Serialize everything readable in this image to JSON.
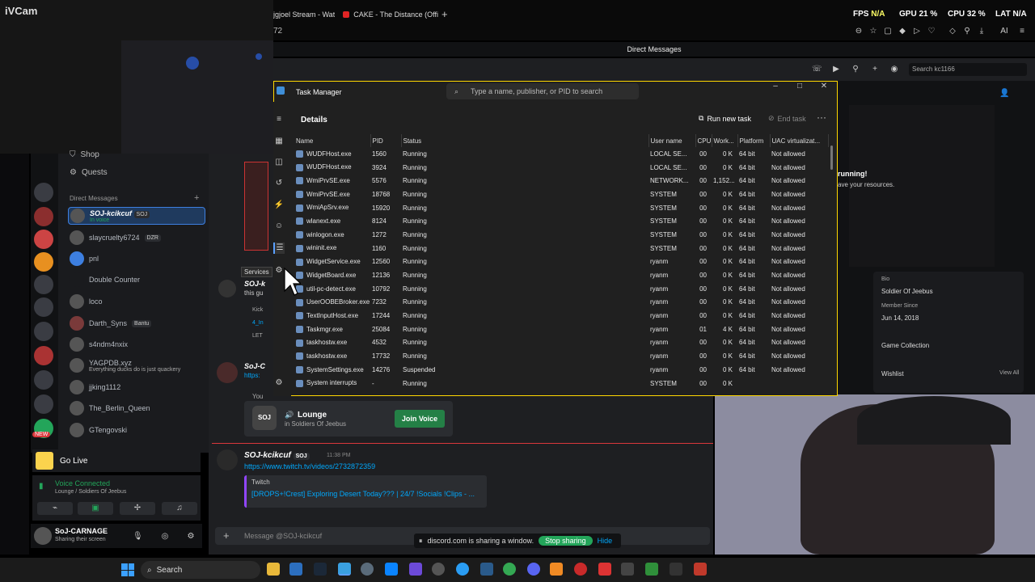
{
  "browser": {
    "tabs": [
      {
        "label": "jgjoel Stream - Wat"
      },
      {
        "label": "CAKE - The Distance (Offi"
      }
    ],
    "new_tab": "+",
    "address_fragment": "72"
  },
  "hud": {
    "fps_label": "FPS",
    "fps_value": "N/A",
    "gpu_label": "GPU",
    "gpu_value": "21 %",
    "cpu_label": "CPU",
    "cpu_value": "32 %",
    "lat_label": "LAT",
    "lat_value": "N/A"
  },
  "ivcam": {
    "label": "iVCam"
  },
  "discord": {
    "header_title": "Direct Messages",
    "search_placeholder": "Search kc1166",
    "nav": {
      "shop": "Shop",
      "quests": "Quests"
    },
    "dm_section": "Direct Messages",
    "dm_plus": "+",
    "dms": [
      {
        "name": "SOJ-kcikcuf",
        "tag": "SOJ",
        "sub": "In voice",
        "active": true
      },
      {
        "name": "slaycruelty6724",
        "tag": "DZR"
      },
      {
        "name": "pnl"
      },
      {
        "name": "Double Counter"
      },
      {
        "name": "loco"
      },
      {
        "name": "Darth_Syns",
        "tag": "Bantu"
      },
      {
        "name": "s4ndm4nxix"
      },
      {
        "name": "YAGPDB.xyz",
        "sub": "Everything ducks do is just quackery"
      },
      {
        "name": "jjking1112"
      },
      {
        "name": "The_Berlin_Queen"
      },
      {
        "name": "GTengovski"
      }
    ],
    "new_badge": "NEW",
    "go_live": "Go Live",
    "voice_connected": "Voice Connected",
    "voice_channel": "Lounge / Soldiers Of Jeebus",
    "user_name": "SoJ-CARNAGE",
    "user_status": "Sharing their screen",
    "invite": {
      "server_tag": "SOJ",
      "name": "Lounge",
      "sub": "in Soldiers Of Jeebus",
      "button": "Join Voice"
    },
    "invite_prefix": "You",
    "message": {
      "author": "SOJ-kcikcuf",
      "tag": "SOJ",
      "time": "11:38 PM",
      "link": "https://www.twitch.tv/videos/2732872359",
      "embed_provider": "Twitch",
      "embed_title": "[DROPS+!Crest] Exploring Desert Today??? | 24/7 !Socials !Clips - ..."
    },
    "composer_placeholder": "Message @SOJ-kcikcuf",
    "share_notice": "discord.com is sharing a window.",
    "stop_sharing": "Stop sharing",
    "hide": "Hide",
    "partial_left": {
      "line1": "SOJ-k",
      "line2": "this gu",
      "line3": "Kick",
      "line4": "4_In",
      "line5": "LET",
      "line6": "SoJ-C",
      "line7": "https:"
    }
  },
  "right_panel": {
    "running": "running!",
    "running_sub": "ave your resources.",
    "bio_label": "Bio",
    "bio": "Soldier Of Jeebus",
    "member_since_label": "Member Since",
    "member_since": "Jun 14, 2018",
    "game_collection": "Game Collection",
    "wishlist": "Wishlist",
    "view_all": "View All"
  },
  "task_manager": {
    "title": "Task Manager",
    "search_placeholder": "Type a name, publisher, or PID to search",
    "page_title": "Details",
    "run_new_task": "Run new task",
    "end_task": "End task",
    "tooltip": "Services",
    "columns": [
      "Name",
      "PID",
      "Status",
      "User name",
      "CPU",
      "Work...",
      "Platform",
      "UAC virtualizat..."
    ],
    "rows": [
      [
        "WUDFHost.exe",
        "1560",
        "Running",
        "LOCAL SE...",
        "00",
        "0 K",
        "64 bit",
        "Not allowed"
      ],
      [
        "WUDFHost.exe",
        "3924",
        "Running",
        "LOCAL SE...",
        "00",
        "0 K",
        "64 bit",
        "Not allowed"
      ],
      [
        "WmiPrvSE.exe",
        "5576",
        "Running",
        "NETWORK...",
        "00",
        "1,152...",
        "64 bit",
        "Not allowed"
      ],
      [
        "WmiPrvSE.exe",
        "18768",
        "Running",
        "SYSTEM",
        "00",
        "0 K",
        "64 bit",
        "Not allowed"
      ],
      [
        "WmiApSrv.exe",
        "15920",
        "Running",
        "SYSTEM",
        "00",
        "0 K",
        "64 bit",
        "Not allowed"
      ],
      [
        "wlanext.exe",
        "8124",
        "Running",
        "SYSTEM",
        "00",
        "0 K",
        "64 bit",
        "Not allowed"
      ],
      [
        "winlogon.exe",
        "1272",
        "Running",
        "SYSTEM",
        "00",
        "0 K",
        "64 bit",
        "Not allowed"
      ],
      [
        "wininit.exe",
        "1160",
        "Running",
        "SYSTEM",
        "00",
        "0 K",
        "64 bit",
        "Not allowed"
      ],
      [
        "WidgetService.exe",
        "12560",
        "Running",
        "ryanm",
        "00",
        "0 K",
        "64 bit",
        "Not allowed"
      ],
      [
        "WidgetBoard.exe",
        "12136",
        "Running",
        "ryanm",
        "00",
        "0 K",
        "64 bit",
        "Not allowed"
      ],
      [
        "util-pc-detect.exe",
        "10792",
        "Running",
        "ryanm",
        "00",
        "0 K",
        "64 bit",
        "Not allowed"
      ],
      [
        "UserOOBEBroker.exe",
        "7232",
        "Running",
        "ryanm",
        "00",
        "0 K",
        "64 bit",
        "Not allowed"
      ],
      [
        "TextInputHost.exe",
        "17244",
        "Running",
        "ryanm",
        "00",
        "0 K",
        "64 bit",
        "Not allowed"
      ],
      [
        "Taskmgr.exe",
        "25084",
        "Running",
        "ryanm",
        "01",
        "4 K",
        "64 bit",
        "Not allowed"
      ],
      [
        "taskhostw.exe",
        "4532",
        "Running",
        "ryanm",
        "00",
        "0 K",
        "64 bit",
        "Not allowed"
      ],
      [
        "taskhostw.exe",
        "17732",
        "Running",
        "ryanm",
        "00",
        "0 K",
        "64 bit",
        "Not allowed"
      ],
      [
        "SystemSettings.exe",
        "14276",
        "Suspended",
        "ryanm",
        "00",
        "0 K",
        "64 bit",
        "Not allowed"
      ],
      [
        "System interrupts",
        "-",
        "Running",
        "SYSTEM",
        "00",
        "0 K",
        "",
        ""
      ]
    ]
  },
  "taskbar": {
    "search": "Search"
  },
  "colors": {
    "tm_border": "#ffd700",
    "discord_green": "#23a55a",
    "link": "#00a8fc"
  }
}
